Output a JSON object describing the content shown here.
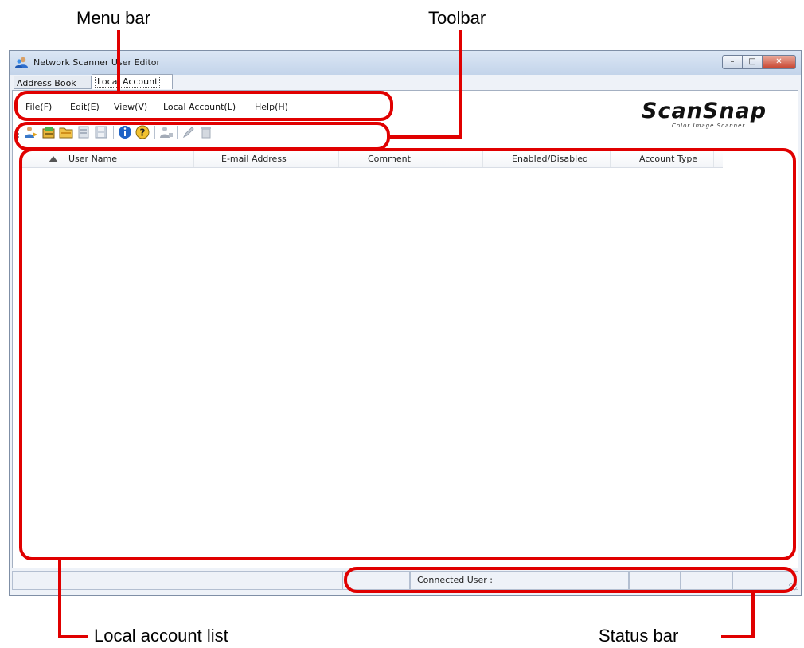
{
  "annotations": {
    "menu_bar": "Menu bar",
    "toolbar": "Toolbar",
    "local_account_list": "Local account list",
    "status_bar": "Status bar"
  },
  "window": {
    "title": "Network Scanner User Editor",
    "minimize": "–",
    "maximize": "□",
    "close": "✕"
  },
  "tabs": [
    {
      "label": "Address Book"
    },
    {
      "label": "Local Account"
    }
  ],
  "menu": [
    {
      "label": "File(F)"
    },
    {
      "label": "Edit(E)"
    },
    {
      "label": "View(V)"
    },
    {
      "label": "Local Account(L)"
    },
    {
      "label": "Help(H)"
    }
  ],
  "logo": {
    "main": "ScanSnap",
    "sub": "Color Image Scanner"
  },
  "toolbar_icons": [
    "connect-icon",
    "import-icon",
    "open-folder-icon",
    "export-icon",
    "save-icon",
    "info-icon",
    "help-icon",
    "add-user-icon",
    "edit-icon",
    "delete-icon"
  ],
  "list": {
    "columns": [
      {
        "label": "User Name"
      },
      {
        "label": "E-mail Address"
      },
      {
        "label": "Comment"
      },
      {
        "label": "Enabled/Disabled"
      },
      {
        "label": "Account Type"
      }
    ],
    "rows": []
  },
  "status": {
    "connected_user_label": "Connected User :"
  },
  "colors": {
    "callout": "#e00000",
    "window_bg": "#eef2f8"
  }
}
